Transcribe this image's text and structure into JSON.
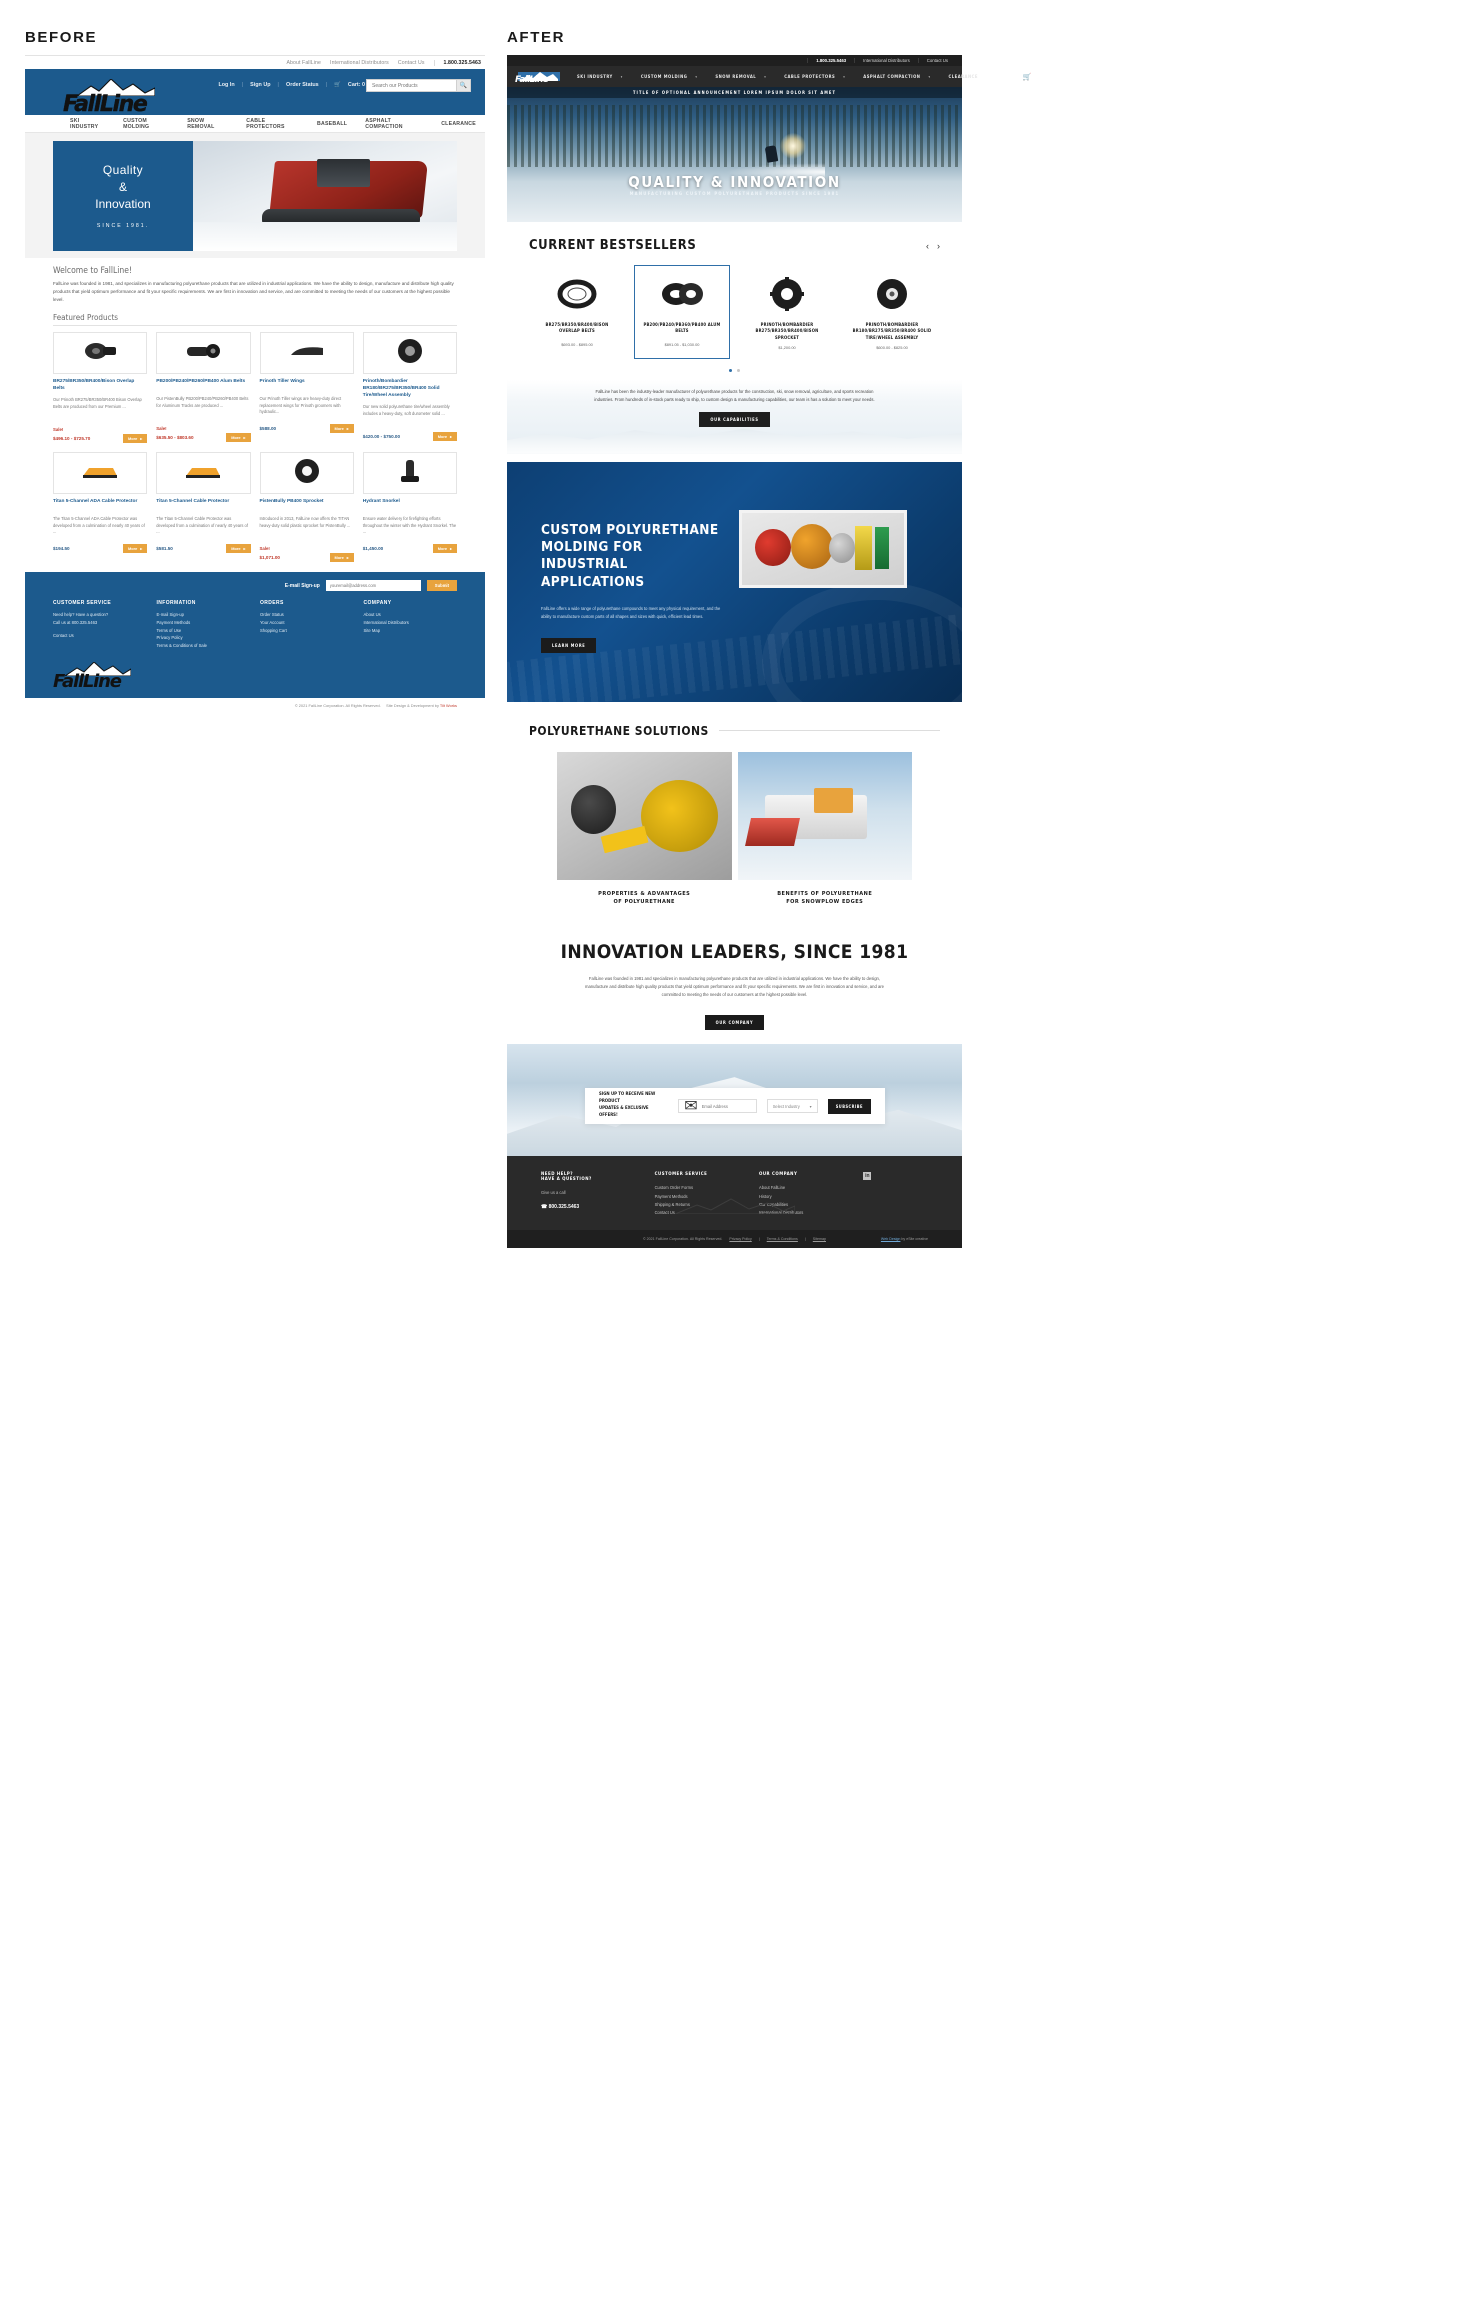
{
  "labels": {
    "before": "BEFORE",
    "after": "AFTER"
  },
  "before": {
    "utility_nav": [
      "About FallLine",
      "International Distributors",
      "Contact Us"
    ],
    "phone": "1.800.325.5463",
    "user_links": [
      "Log In",
      "Sign Up",
      "Order Status"
    ],
    "cart": "Cart: 0",
    "search_placeholder": "Search our Products",
    "search_icon": "search-icon",
    "logo": "FallLine",
    "category_nav": [
      "SKI INDUSTRY",
      "CUSTOM MOLDING",
      "SNOW REMOVAL",
      "CABLE PROTECTORS",
      "BASEBALL",
      "ASPHALT COMPACTION",
      "CLEARANCE"
    ],
    "hero": {
      "line1": "Quality",
      "line2": "&",
      "line3": "Innovation",
      "since": "SINCE 1981."
    },
    "welcome_title": "Welcome to FallLine!",
    "welcome_body": "FallLine was founded in 1981, and specializes in manufacturing polyurethane products that are utilized in industrial applications. We have the ability to design, manufacture and distribute high quality products that yield optimum performance and fit your specific requirements. We are first in innovation and service, and are committed to meeting the needs of our customers at the highest possible level.",
    "featured_title": "Featured Products",
    "products": [
      {
        "name": "BR275/BR350/BR400/Bison Overlap Belts",
        "desc": "Our Prinoth BR275/BR350/BR400 Bison Overlap Belts are produced from our Premium ...",
        "sale_label": "Sale!",
        "price": "$496.10 - $725.70",
        "price_is_sale": true,
        "more": "More"
      },
      {
        "name": "PB200/PB240/PB260/PB400 Alum Belts",
        "desc": "Our PistenBully PB200/PB240/PB260/PB400 Belts for Aluminum Tracks are produced ...",
        "sale_label": "Sale!",
        "price": "$635.50 - $803.60",
        "price_is_sale": true,
        "more": "More"
      },
      {
        "name": "Prinoth Tiller Wings",
        "desc": "Our Prinoth Tiller wings are heavy-duty direct replacement wings for Prinoth groomers with hydraulic...",
        "sale_label": "",
        "price": "$588.00",
        "price_is_sale": false,
        "more": "More"
      },
      {
        "name": "Prinoth/Bombardier BR180/BR275/BR350/BR400 Solid Tire/Wheel Assembly",
        "desc": "Our new solid polyurethane tire/wheel assembly includes a heavy-duty, soft durometer solid ...",
        "sale_label": "",
        "price": "$420.00 - $750.00",
        "price_is_sale": false,
        "more": "More"
      },
      {
        "name": "Titan 5-Channel ADA Cable Protector",
        "desc": "The Titan 5-Channel ADA Cable Protector was developed from a culmination of nearly 40 years of ...",
        "sale_label": "",
        "price": "$194.50",
        "price_is_sale": false,
        "more": "More"
      },
      {
        "name": "Titan 5-Channel Cable Protector",
        "desc": "The Titan 5-Channel Cable Protector was developed from a culmination of nearly 40 years of ...",
        "sale_label": "",
        "price": "$581.50",
        "price_is_sale": false,
        "more": "More"
      },
      {
        "name": "PistenBully PB400 Sprocket",
        "desc": "Introduced in 2013, FallLine now offers the TITAN heavy-duty solid plastic sprocket for PistenBully ...",
        "sale_label": "Sale!",
        "price": "$1,071.00",
        "price_is_sale": true,
        "more": "More"
      },
      {
        "name": "Hydrant Snorkel",
        "desc": "Ensure water delivery for firefighting efforts throughout the winter with the Hydrant Snorkel. The ...",
        "sale_label": "",
        "price": "$1,450.00",
        "price_is_sale": false,
        "more": "More"
      }
    ],
    "signup_label": "E-mail Sign-up",
    "signup_placeholder": "youremail@address.com",
    "signup_button": "Submit",
    "footer_columns": [
      {
        "title": "CUSTOMER SERVICE",
        "lines": [
          "Need help? Have a question?",
          "Call us at 800.325.5463",
          "",
          "Contact Us"
        ]
      },
      {
        "title": "INFORMATION",
        "lines": [
          "E-mail Sign-up",
          "Payment Methods",
          "Terms of Use",
          "Privacy Policy",
          "Terms & Conditions of Sale"
        ]
      },
      {
        "title": "ORDERS",
        "lines": [
          "Order Status",
          "Your Account",
          "Shopping Cart"
        ]
      },
      {
        "title": "COMPANY",
        "lines": [
          "About Us",
          "International Distributors",
          "Site Map"
        ]
      }
    ],
    "copyright": "© 2021 FallLine Corporation. All Rights Reserved.",
    "credit_prefix": "Site Design & Development by ",
    "credit_link": "Tilt Works"
  },
  "after": {
    "topbar": {
      "phone": "1.800.325.5463",
      "links": [
        "International Distributors",
        "Contact Us"
      ]
    },
    "logo": "FallLine",
    "nav": [
      {
        "label": "SKI INDUSTRY",
        "caret": true
      },
      {
        "label": "CUSTOM MOLDING",
        "caret": true
      },
      {
        "label": "SNOW REMOVAL",
        "caret": true
      },
      {
        "label": "CABLE PROTECTORS",
        "caret": true
      },
      {
        "label": "ASPHALT COMPACTION",
        "caret": true
      },
      {
        "label": "CLEARANCE",
        "caret": false
      }
    ],
    "header_icons": [
      "search-icon",
      "account-icon",
      "cart-icon"
    ],
    "hero": {
      "announcement": "TITLE OF OPTIONAL ANNOUNCEMENT LOREM IPSUM DOLOR SIT AMET",
      "title": "QUALITY & INNOVATION",
      "subtitle": "MANUFACTURING CUSTOM POLYURETHANE PRODUCTS SINCE 1981"
    },
    "bestsellers": {
      "title": "CURRENT BESTSELLERS",
      "prev_icon": "chevron-left-icon",
      "next_icon": "chevron-right-icon",
      "items": [
        {
          "name": "BR275/BR350/BR400/BISON OVERLAP BELTS",
          "price": "$693.00 - $895.00",
          "active": false
        },
        {
          "name": "PB200/PB240/PB360/PB400 ALUM BELTS",
          "price": "$891.05 - $1,030.00",
          "active": true
        },
        {
          "name": "PRINOTH/BOMBARDIER BR275/BR350/BR400/BISON SPROCKET",
          "price": "$1,200.00",
          "active": false
        },
        {
          "name": "PRINOTH/BOMBARDIER BR180/BR275/BR350/BR400 SOLID TIRE/WHEEL ASSEMBLY",
          "price": "$600.00 - $825.00",
          "active": false
        }
      ],
      "dots": [
        true,
        false
      ]
    },
    "capabilities": {
      "body": "FallLine has been the industry-leader manufacturer of polyurethane products for the construction, ski, snow removal, agriculture, and sports recreation industries. From hundreds of in-stock parts ready to ship, to custom design & manufacturing capabilities, our team is has a solution to meet your needs.",
      "button": "OUR CAPABILITIES"
    },
    "custom": {
      "title": "CUSTOM POLYURETHANE MOLDING FOR INDUSTRIAL APPLICATIONS",
      "body": "FallLine offers a wide range of polyurethane compounds to meet any physical requirement, and the ability to manufacture custom parts of all shapes and sizes with quick, efficient lead times.",
      "button": "LEARN MORE"
    },
    "solutions": {
      "title": "POLYURETHANE SOLUTIONS",
      "cards": [
        {
          "caption_l1": "PROPERTIES & ADVANTAGES",
          "caption_l2": "OF POLYURETHANE"
        },
        {
          "caption_l1": "BENEFITS OF POLYURETHANE",
          "caption_l2": "FOR SNOWPLOW EDGES"
        }
      ]
    },
    "innovation": {
      "title": "INNOVATION LEADERS, SINCE 1981",
      "body": "FallLine was founded in 1981 and specializes in manufacturing polyurethane products that are utilized in industrial applications. We have the ability to design, manufacture and distribute high quality products that yield optimum performance and fit your specific requirements. We are first in innovation and service, and are committed to meeting the needs of our customers at the highest possible level.",
      "button": "OUR COMPANY"
    },
    "newsletter": {
      "text_l1": "SIGN UP TO RECEIVE NEW PRODUCT",
      "text_l2": "UPDATES & EXCLUSIVE OFFERS!",
      "email_icon": "envelope-icon",
      "email_placeholder": "Email Address",
      "select_value": "Select Industry",
      "select_icon": "chevron-down-icon",
      "button": "SUBSCRIBE"
    },
    "footer": {
      "help_title_l1": "NEED HELP?",
      "help_title_l2": "HAVE A QUESTION?",
      "help_sub": "Give us a call",
      "phone_icon": "phone-icon",
      "phone": "800.325.5463",
      "columns": [
        {
          "title": "CUSTOMER SERVICE",
          "links": [
            "Custom Order Forms",
            "Payment Methods",
            "Shipping & Returns",
            "Contact Us"
          ]
        },
        {
          "title": "OUR COMPANY",
          "links": [
            "About FallLine",
            "History",
            "Our Capabilities",
            "International Distributors"
          ]
        }
      ],
      "social_icon": "linkedin-icon",
      "social_label": "in"
    },
    "legal": {
      "copyright": "© 2021 FallLine Corporation. All Rights Reserved.",
      "links": [
        "Privacy Policy",
        "Terms & Conditions",
        "Sitemap"
      ],
      "credit_prefix": "Web Design",
      "credit_suffix": " by eSite creative"
    }
  },
  "colors": {
    "before_blue": "#1c5a8d",
    "after_dark": "#2a2a2a",
    "accent_orange": "#e8a33d",
    "sale_red": "#c0392b",
    "after_blue": "#13518f"
  }
}
